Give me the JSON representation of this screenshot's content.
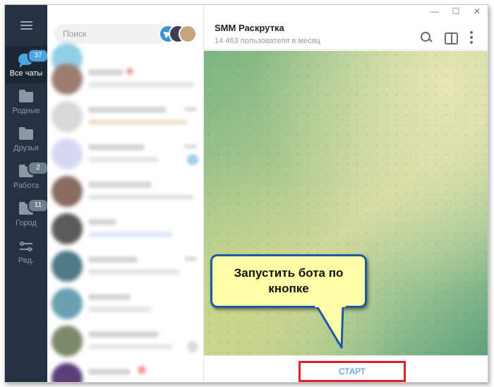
{
  "window": {
    "controls": [
      "—",
      "☐",
      "✕"
    ]
  },
  "sidebar": {
    "menu_icon": "hamburger-icon",
    "folders": [
      {
        "label": "Все чаты",
        "badge": "37",
        "icon": "chat-bubble-icon",
        "active": true
      },
      {
        "label": "Родные",
        "badge": "",
        "icon": "folder-icon"
      },
      {
        "label": "Друзья",
        "badge": "",
        "icon": "folder-icon"
      },
      {
        "label": "Работа",
        "badge": "2",
        "icon": "folder-icon"
      },
      {
        "label": "Город",
        "badge": "11",
        "icon": "folder-icon"
      },
      {
        "label": "Ред.",
        "badge": "",
        "icon": "sliders-icon"
      }
    ]
  },
  "chat_list": {
    "search_placeholder": "Поиск"
  },
  "chat": {
    "title": "SMM Раскрутка",
    "subtitle": "14 463 пользователя в месяц",
    "start_label": "СТАРТ"
  },
  "callout": {
    "text": "Запустить бота по кнопке"
  },
  "colors": {
    "rail": "#253242",
    "accent": "#4fa3e0",
    "highlight_border": "#e0202a",
    "callout_fill": "#fefea6",
    "callout_border": "#1d57a8"
  }
}
